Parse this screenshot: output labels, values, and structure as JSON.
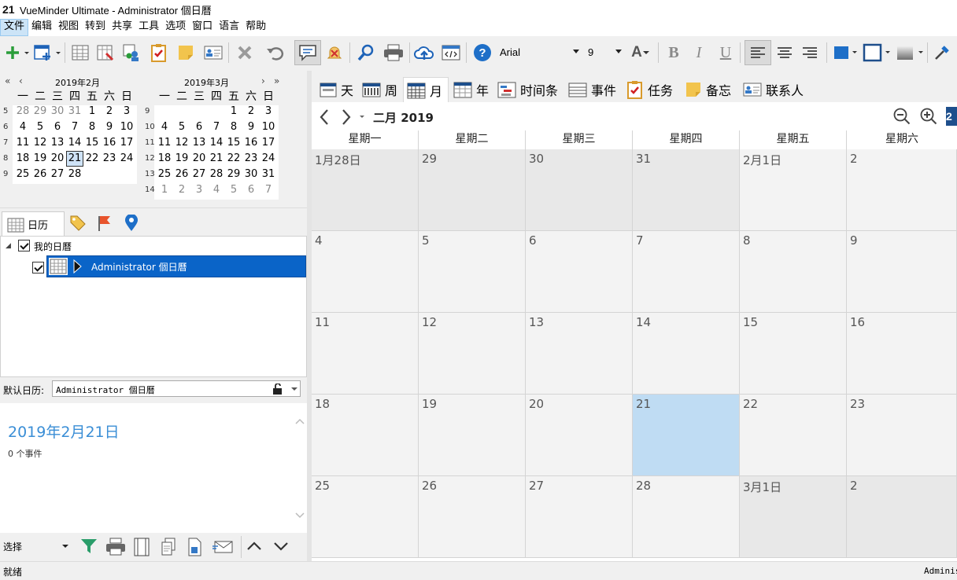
{
  "window": {
    "app_icon_text": "21",
    "title": "VueMinder Ultimate - Administrator 個日曆"
  },
  "menu": [
    "文件",
    "编辑",
    "视图",
    "转到",
    "共享",
    "工具",
    "选项",
    "窗口",
    "语言",
    "帮助"
  ],
  "toolbar": {
    "font_name": "Arial",
    "font_size": "9",
    "bold": "B",
    "italic": "I",
    "underline": "U",
    "font_color_letter": "A"
  },
  "mini_calendars": [
    {
      "title": "2019年2月",
      "weekdays": [
        "一",
        "二",
        "三",
        "四",
        "五",
        "六",
        "日"
      ],
      "weeks": [
        {
          "wk": "5",
          "days": [
            "28",
            "29",
            "30",
            "31",
            "1",
            "2",
            "3"
          ]
        },
        {
          "wk": "6",
          "days": [
            "4",
            "5",
            "6",
            "7",
            "8",
            "9",
            "10"
          ]
        },
        {
          "wk": "7",
          "days": [
            "11",
            "12",
            "13",
            "14",
            "15",
            "16",
            "17"
          ]
        },
        {
          "wk": "8",
          "days": [
            "18",
            "19",
            "20",
            "21",
            "22",
            "23",
            "24"
          ]
        },
        {
          "wk": "9",
          "days": [
            "25",
            "26",
            "27",
            "28",
            "",
            "",
            ""
          ]
        }
      ]
    },
    {
      "title": "2019年3月",
      "weekdays": [
        "一",
        "二",
        "三",
        "四",
        "五",
        "六",
        "日"
      ],
      "weeks": [
        {
          "wk": "9",
          "days": [
            "",
            "",
            "",
            "",
            "1",
            "2",
            "3"
          ]
        },
        {
          "wk": "10",
          "days": [
            "4",
            "5",
            "6",
            "7",
            "8",
            "9",
            "10"
          ]
        },
        {
          "wk": "11",
          "days": [
            "11",
            "12",
            "13",
            "14",
            "15",
            "16",
            "17"
          ]
        },
        {
          "wk": "12",
          "days": [
            "18",
            "19",
            "20",
            "21",
            "22",
            "23",
            "24"
          ]
        },
        {
          "wk": "13",
          "days": [
            "25",
            "26",
            "27",
            "28",
            "29",
            "30",
            "31"
          ]
        },
        {
          "wk": "14",
          "days": [
            "1",
            "2",
            "3",
            "4",
            "5",
            "6",
            "7"
          ]
        }
      ]
    }
  ],
  "nav_tabs": {
    "calendar_label": "日历"
  },
  "tree": {
    "root_label": "我的日曆",
    "child_label": "Administrator 個日曆"
  },
  "default_calendar": {
    "label": "默认日历:",
    "value": "Administrator 個日曆"
  },
  "detail": {
    "date": "2019年2月21日",
    "count": "0 个事件"
  },
  "bottom": {
    "select_label": "选择"
  },
  "status": {
    "left": "就绪",
    "right": "Adminis"
  },
  "view_tabs": [
    "天",
    "周",
    "月",
    "年",
    "时间条",
    "事件",
    "任务",
    "备忘",
    "联系人"
  ],
  "month_view": {
    "title": "二月 2019",
    "weekdays": [
      "星期一",
      "星期二",
      "星期三",
      "星期四",
      "星期五",
      "星期六"
    ],
    "weeks": [
      [
        "1月28日",
        "29",
        "30",
        "31",
        "2月1日",
        "2"
      ],
      [
        "4",
        "5",
        "6",
        "7",
        "8",
        "9"
      ],
      [
        "11",
        "12",
        "13",
        "14",
        "15",
        "16"
      ],
      [
        "18",
        "19",
        "20",
        "21",
        "22",
        "23"
      ],
      [
        "25",
        "26",
        "27",
        "28",
        "3月1日",
        "2"
      ]
    ]
  },
  "colors": {
    "accent": "#0078d7",
    "today": "#bfdcf3",
    "date_blue": "#3a8ed6"
  }
}
